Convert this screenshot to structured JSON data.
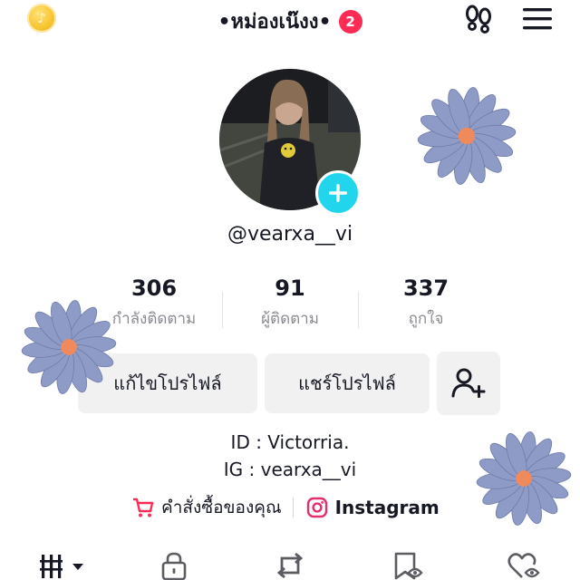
{
  "header": {
    "title": "•หม่องเน๊งง•",
    "notification_count": "2"
  },
  "profile": {
    "username": "@vearxa__vi"
  },
  "stats": [
    {
      "value": "306",
      "label": "กำลังติดตาม"
    },
    {
      "value": "91",
      "label": "ผู้ติดตาม"
    },
    {
      "value": "337",
      "label": "ถูกใจ"
    }
  ],
  "actions": {
    "edit_profile": "แก้ไขโปรไฟล์",
    "share_profile": "แชร์โปรไฟล์"
  },
  "bio": {
    "line1": "ID : Victorria.",
    "line2": "IG : vearxa__vi"
  },
  "links": {
    "orders": "คำสั่งซื้อของคุณ",
    "instagram": "Instagram"
  },
  "colors": {
    "accent_red": "#fe2c55",
    "plus_cyan": "#20d5ec",
    "button_bg": "#f1f1f2",
    "muted_text": "#8a8b91",
    "flower_petal": "#8e9bc6",
    "flower_center": "#f08a5d"
  },
  "icons": [
    "coin-icon",
    "footprints-icon",
    "menu-icon",
    "plus-icon",
    "add-friend-icon",
    "cart-icon",
    "instagram-icon",
    "grid-icon",
    "lock-icon",
    "repost-icon",
    "bookmark-icon",
    "liked-icon"
  ]
}
